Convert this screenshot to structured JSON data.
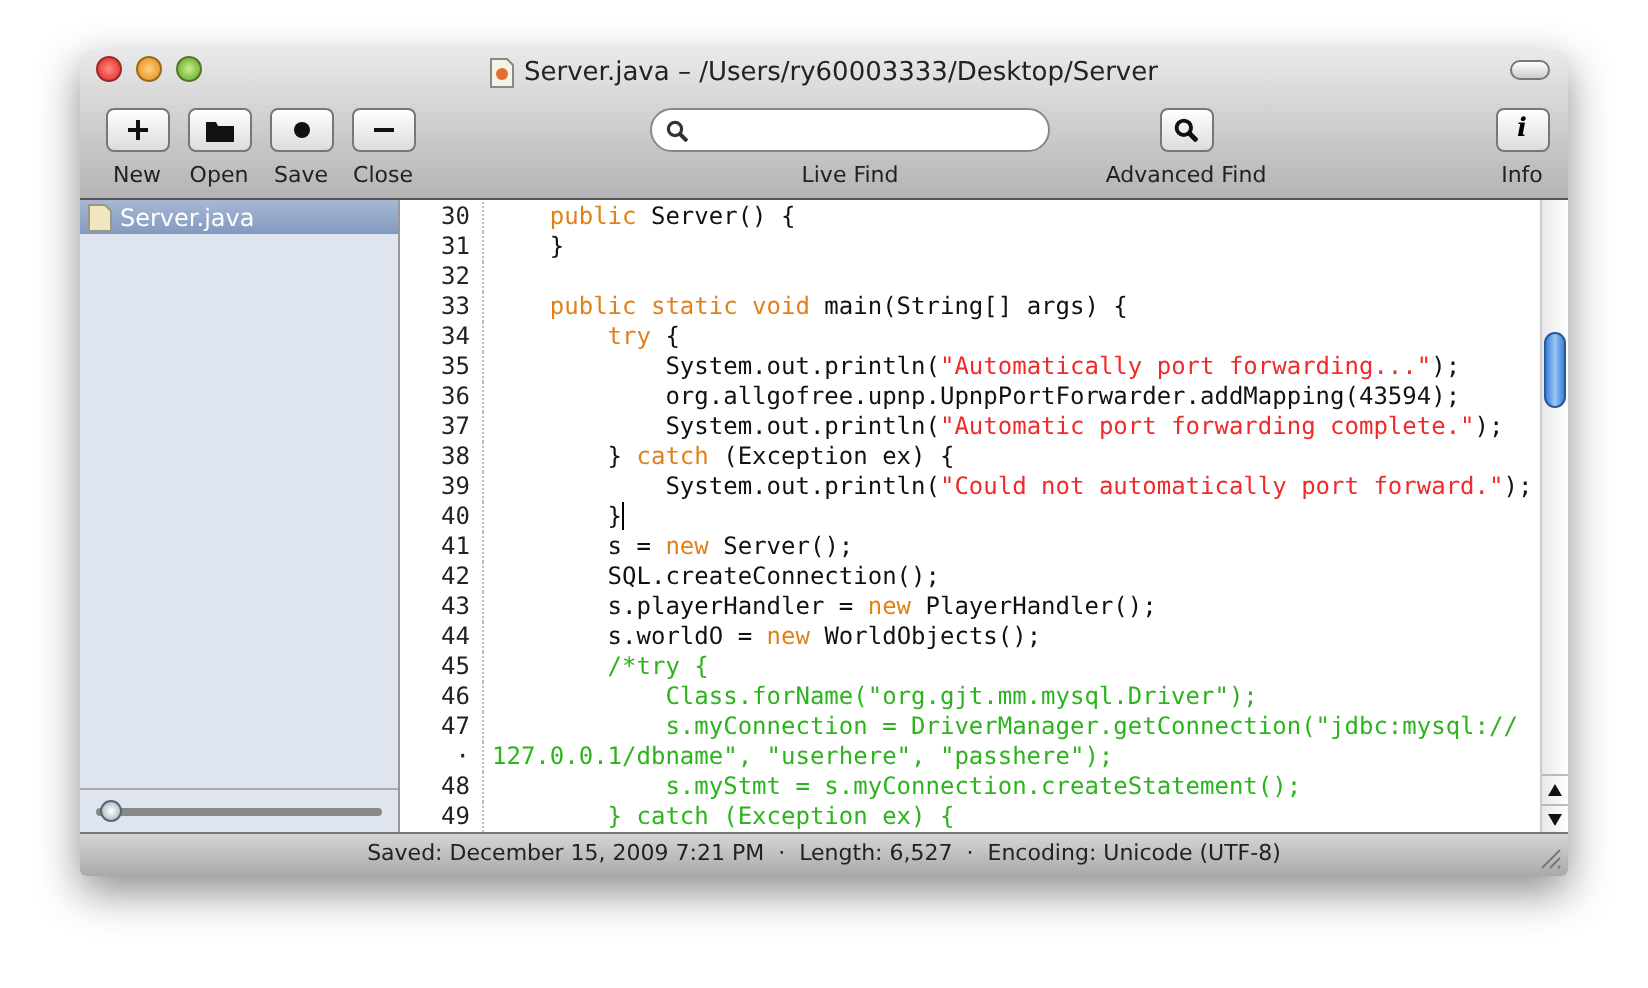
{
  "window": {
    "title": "Server.java – /Users/ry60003333/Desktop/Server"
  },
  "toolbar": {
    "left_buttons": [
      {
        "label": "New",
        "kind": "plus"
      },
      {
        "label": "Open",
        "kind": "folder"
      },
      {
        "label": "Save",
        "kind": "dot"
      },
      {
        "label": "Close",
        "kind": "minus"
      }
    ],
    "search": {
      "label": "Live Find"
    },
    "advanced_find": {
      "label": "Advanced Find"
    },
    "info": {
      "label": "Info",
      "glyph": "i"
    }
  },
  "sidebar": {
    "items": [
      {
        "name": "Server.java",
        "selected": true
      }
    ],
    "zoom_slider": {
      "level": 0.02
    }
  },
  "editor": {
    "scroll": {
      "level": 0.2
    },
    "lines": [
      {
        "number": "30",
        "cursor": false,
        "segments": [
          {
            "kind": "keyword",
            "text": "    public"
          },
          {
            "kind": "plain",
            "text": " Server() {"
          }
        ]
      },
      {
        "number": "31",
        "cursor": false,
        "segments": [
          {
            "kind": "plain",
            "text": "    }"
          }
        ]
      },
      {
        "number": "32",
        "cursor": false
      },
      {
        "number": "33",
        "cursor": false,
        "segments": [
          {
            "kind": "keyword",
            "text": "    public static void"
          },
          {
            "kind": "plain",
            "text": " main(String[] args) {"
          }
        ]
      },
      {
        "number": "34",
        "cursor": false,
        "segments": [
          {
            "kind": "keyword",
            "text": "        try"
          },
          {
            "kind": "plain",
            "text": " {"
          }
        ]
      },
      {
        "number": "35",
        "cursor": false,
        "segments": [
          {
            "kind": "plain",
            "text": "            System.out.println("
          },
          {
            "kind": "string",
            "text": "\"Automatically port forwarding...\""
          },
          {
            "kind": "plain",
            "text": ");"
          }
        ]
      },
      {
        "number": "36",
        "cursor": false,
        "segments": [
          {
            "kind": "plain",
            "text": "            org.allgofree.upnp.UpnpPortForwarder.addMapping(43594);"
          }
        ]
      },
      {
        "number": "37",
        "cursor": false,
        "segments": [
          {
            "kind": "plain",
            "text": "            System.out.println("
          },
          {
            "kind": "string",
            "text": "\"Automatic port forwarding complete.\""
          },
          {
            "kind": "plain",
            "text": ");"
          }
        ]
      },
      {
        "number": "38",
        "cursor": false,
        "segments": [
          {
            "kind": "plain",
            "text": "        } "
          },
          {
            "kind": "keyword",
            "text": "catch"
          },
          {
            "kind": "plain",
            "text": " (Exception ex) {"
          }
        ]
      },
      {
        "number": "39",
        "cursor": false,
        "segments": [
          {
            "kind": "plain",
            "text": "            System.out.println("
          },
          {
            "kind": "string",
            "text": "\"Could not automatically port forward.\""
          },
          {
            "kind": "plain",
            "text": ");"
          }
        ]
      },
      {
        "number": "40",
        "cursor": true,
        "segments": [
          {
            "kind": "plain",
            "text": "        }"
          }
        ]
      },
      {
        "number": "41",
        "cursor": false,
        "segments": [
          {
            "kind": "plain",
            "text": "        s = "
          },
          {
            "kind": "keyword",
            "text": "new"
          },
          {
            "kind": "plain",
            "text": " Server();"
          }
        ]
      },
      {
        "number": "42",
        "cursor": false,
        "segments": [
          {
            "kind": "plain",
            "text": "        SQL.createConnection();"
          }
        ]
      },
      {
        "number": "43",
        "cursor": false,
        "segments": [
          {
            "kind": "plain",
            "text": "        s.playerHandler = "
          },
          {
            "kind": "keyword",
            "text": "new"
          },
          {
            "kind": "plain",
            "text": " PlayerHandler();"
          }
        ]
      },
      {
        "number": "44",
        "cursor": false,
        "segments": [
          {
            "kind": "plain",
            "text": "        s.worldO = "
          },
          {
            "kind": "keyword",
            "text": "new"
          },
          {
            "kind": "plain",
            "text": " WorldObjects();"
          }
        ]
      },
      {
        "number": "45",
        "cursor": false,
        "segments": [
          {
            "kind": "comment",
            "text": "        /*try {"
          }
        ]
      },
      {
        "number": "46",
        "cursor": false,
        "segments": [
          {
            "kind": "comment",
            "text": "            Class.forName(\"org.gjt.mm.mysql.Driver\");"
          }
        ]
      },
      {
        "number": "47",
        "cursor": false,
        "segments": [
          {
            "kind": "comment",
            "text": "            s.myConnection = DriverManager.getConnection(\"jdbc:mysql://"
          }
        ]
      },
      {
        "number": "·",
        "cursor": false,
        "segments": [
          {
            "kind": "comment",
            "text": "127.0.0.1/dbname\", \"userhere\", \"passhere\");"
          }
        ]
      },
      {
        "number": "48",
        "cursor": false,
        "segments": [
          {
            "kind": "comment",
            "text": "            s.myStmt = s.myConnection.createStatement();"
          }
        ]
      },
      {
        "number": "49",
        "cursor": false,
        "segments": [
          {
            "kind": "comment",
            "text": "        } catch (Exception ex) {"
          }
        ]
      }
    ]
  },
  "status_bar": {
    "parts": [
      "Saved: December 15, 2009 7:21 PM",
      "Length: 6,527",
      "Encoding: Unicode (UTF-8)"
    ],
    "separator": "·"
  }
}
